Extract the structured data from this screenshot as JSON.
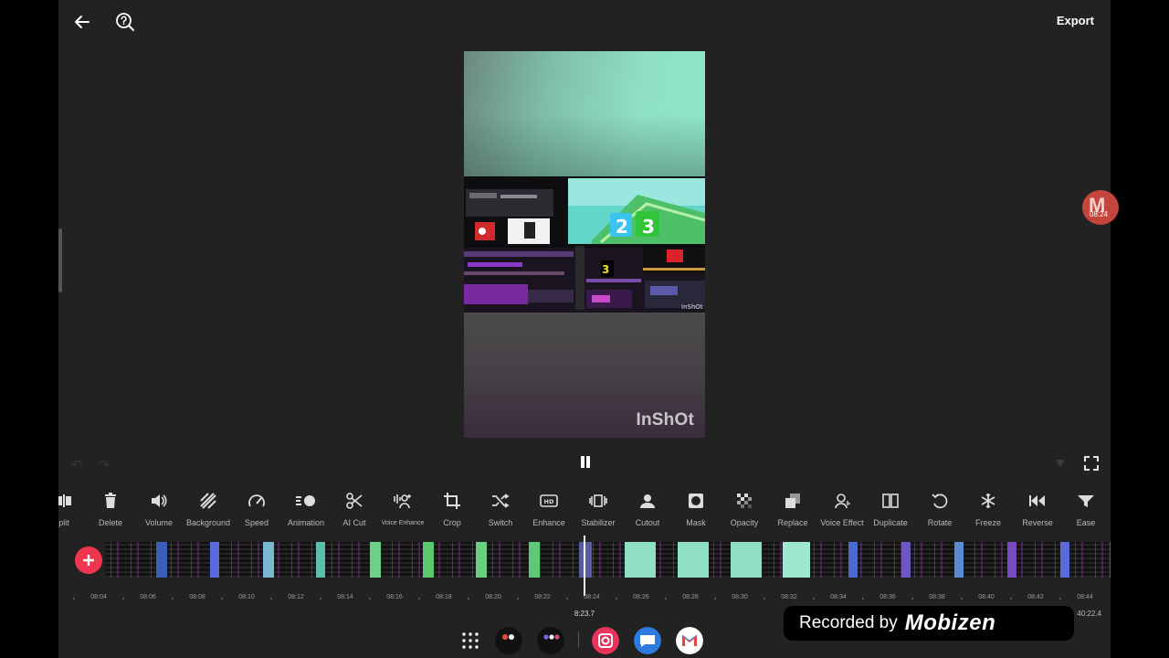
{
  "app": {
    "watermark": "InShOt"
  },
  "header": {
    "export_label": "Export"
  },
  "toolbar": {
    "items": [
      {
        "label": "plit",
        "icon": "split-icon"
      },
      {
        "label": "Delete",
        "icon": "trash-icon"
      },
      {
        "label": "Volume",
        "icon": "volume-icon"
      },
      {
        "label": "Background",
        "icon": "background-icon"
      },
      {
        "label": "Speed",
        "icon": "speed-icon"
      },
      {
        "label": "Animation",
        "icon": "animation-icon"
      },
      {
        "label": "AI Cut",
        "icon": "ai-cut-icon"
      },
      {
        "label": "Voice Enhance",
        "icon": "voice-enhance-icon"
      },
      {
        "label": "Crop",
        "icon": "crop-icon"
      },
      {
        "label": "Switch",
        "icon": "shuffle-icon"
      },
      {
        "label": "Enhance",
        "icon": "hd-icon"
      },
      {
        "label": "Stabilizer",
        "icon": "stabilizer-icon"
      },
      {
        "label": "Cutout",
        "icon": "cutout-icon"
      },
      {
        "label": "Mask",
        "icon": "mask-icon"
      },
      {
        "label": "Opacity",
        "icon": "opacity-icon"
      },
      {
        "label": "Replace",
        "icon": "replace-icon"
      },
      {
        "label": "Voice Effect",
        "icon": "voice-effect-icon"
      },
      {
        "label": "Duplicate",
        "icon": "duplicate-icon"
      },
      {
        "label": "Rotate",
        "icon": "rotate-icon"
      },
      {
        "label": "Freeze",
        "icon": "snowflake-icon"
      },
      {
        "label": "Reverse",
        "icon": "reverse-icon"
      },
      {
        "label": "Ease",
        "icon": "ease-icon"
      }
    ]
  },
  "timeline": {
    "ticks": [
      "08:04",
      "08:06",
      "08:08",
      "08:10",
      "08:12",
      "08:14",
      "08:16",
      "08:18",
      "08:20",
      "08:22",
      "08:24",
      "08:26",
      "08:28",
      "08:30",
      "08:32",
      "08:34",
      "08:36",
      "08:38",
      "08:40",
      "08:42",
      "08:44"
    ],
    "current_time": "8:23.7",
    "total_time": "40:22.4"
  },
  "overlay": {
    "recorded_text": "Recorded by",
    "recorded_brand": "Mobizen",
    "bubble_letter": "M",
    "bubble_time": "08:24"
  },
  "colors": {
    "accent": "#f0364e",
    "background": "#222222",
    "recorder": "#c4453b"
  }
}
